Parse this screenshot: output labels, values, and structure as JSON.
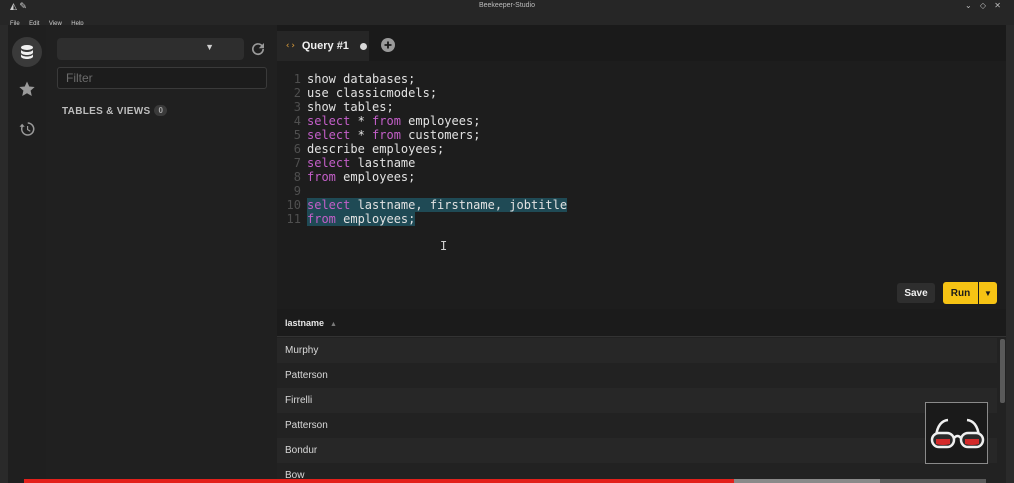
{
  "window": {
    "title": "Beekeeper-Studio"
  },
  "menu": [
    "File",
    "Edit",
    "View",
    "Help"
  ],
  "sidebar": {
    "filter_placeholder": "Filter",
    "tables_header": "TABLES & VIEWS",
    "tables_count": "0"
  },
  "tabs": [
    {
      "label": "Query #1",
      "icon": "code-icon",
      "unsaved": true
    }
  ],
  "editor": {
    "lines": [
      {
        "n": "1",
        "tokens": [
          [
            "",
            "show databases;"
          ]
        ]
      },
      {
        "n": "2",
        "tokens": [
          [
            "",
            "use classicmodels;"
          ]
        ]
      },
      {
        "n": "3",
        "tokens": [
          [
            "",
            "show tables;"
          ]
        ]
      },
      {
        "n": "4",
        "tokens": [
          [
            "kw",
            "select"
          ],
          [
            "",
            " * "
          ],
          [
            "kw",
            "from"
          ],
          [
            "",
            " employees;"
          ]
        ]
      },
      {
        "n": "5",
        "tokens": [
          [
            "kw",
            "select"
          ],
          [
            "",
            " * "
          ],
          [
            "kw",
            "from"
          ],
          [
            "",
            " customers;"
          ]
        ]
      },
      {
        "n": "6",
        "tokens": [
          [
            "",
            "describe employees;"
          ]
        ]
      },
      {
        "n": "7",
        "tokens": [
          [
            "kw",
            "select"
          ],
          [
            "",
            " lastname"
          ]
        ]
      },
      {
        "n": "8",
        "tokens": [
          [
            "kw",
            "from"
          ],
          [
            "",
            " employees;"
          ]
        ]
      },
      {
        "n": "9",
        "tokens": []
      },
      {
        "n": "10",
        "selected": true,
        "tokens": [
          [
            "kw",
            "select"
          ],
          [
            "",
            " lastname, firstname, jobtitle"
          ]
        ]
      },
      {
        "n": "11",
        "selected": true,
        "tokens": [
          [
            "kw",
            "from"
          ],
          [
            "",
            " employees;"
          ]
        ]
      }
    ]
  },
  "actions": {
    "save_label": "Save",
    "run_label": "Run"
  },
  "results": {
    "column": "lastname",
    "rows": [
      "Murphy",
      "Patterson",
      "Firrelli",
      "Patterson",
      "Bondur",
      "Bow"
    ]
  },
  "video": {
    "progress": 0.738,
    "buffered": 0.89
  },
  "colors": {
    "run": "#f6c314",
    "keyword": "#c45fc9",
    "selection": "#1f4a55",
    "progress": "#e3201b"
  }
}
